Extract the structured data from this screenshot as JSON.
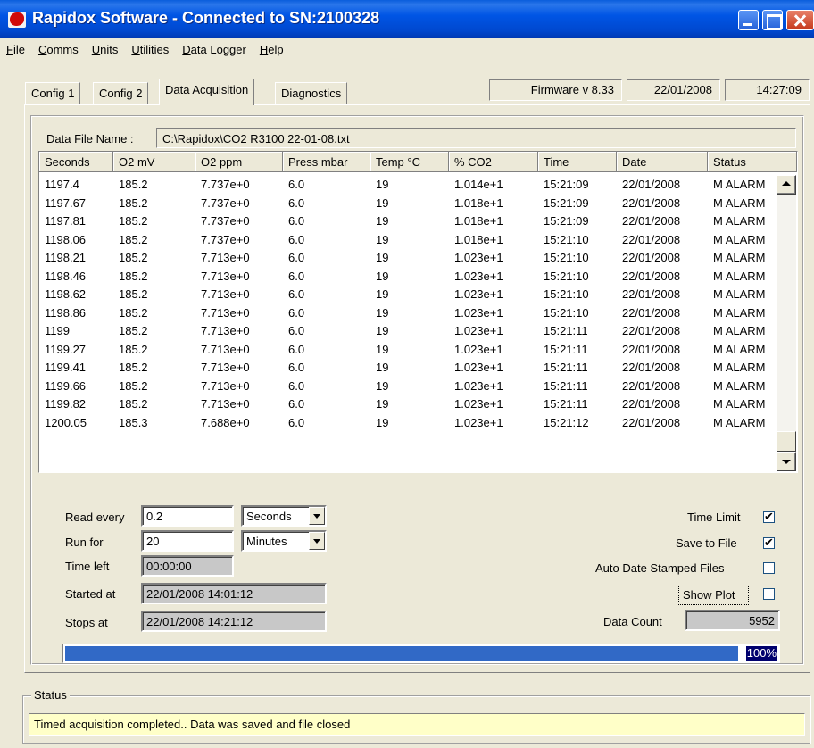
{
  "window": {
    "title": "Rapidox Software - Connected to SN:2100328"
  },
  "menu": [
    {
      "label": "File"
    },
    {
      "label": "Comms"
    },
    {
      "label": "Units"
    },
    {
      "label": "Utilities"
    },
    {
      "label": "Data Logger"
    },
    {
      "label": "Help"
    }
  ],
  "tabs": [
    {
      "label": "Config 1"
    },
    {
      "label": "Config 2"
    },
    {
      "label": "Data Acquisition"
    },
    {
      "label": "Diagnostics"
    }
  ],
  "info": {
    "firmware": "Firmware v 8.33",
    "date": "22/01/2008",
    "time": "14:27:09"
  },
  "data_file": {
    "label": "Data File Name :",
    "path": "C:\\Rapidox\\CO2 R3100 22-01-08.txt"
  },
  "table": {
    "headers": [
      "Seconds",
      "O2 mV",
      "O2 ppm",
      "Press mbar",
      "Temp °C",
      "% CO2",
      "Time",
      "Date",
      "Status"
    ],
    "rows": [
      [
        "1197.4",
        "185.2",
        "7.737e+0",
        "6.0",
        "19",
        "1.014e+1",
        "15:21:09",
        "22/01/2008",
        "M  ALARM"
      ],
      [
        "1197.67",
        "185.2",
        "7.737e+0",
        "6.0",
        "19",
        "1.018e+1",
        "15:21:09",
        "22/01/2008",
        "M  ALARM"
      ],
      [
        "1197.81",
        "185.2",
        "7.737e+0",
        "6.0",
        "19",
        "1.018e+1",
        "15:21:09",
        "22/01/2008",
        "M  ALARM"
      ],
      [
        "1198.06",
        "185.2",
        "7.737e+0",
        "6.0",
        "19",
        "1.018e+1",
        "15:21:10",
        "22/01/2008",
        "M  ALARM"
      ],
      [
        "1198.21",
        "185.2",
        "7.713e+0",
        "6.0",
        "19",
        "1.023e+1",
        "15:21:10",
        "22/01/2008",
        "M  ALARM"
      ],
      [
        "1198.46",
        "185.2",
        "7.713e+0",
        "6.0",
        "19",
        "1.023e+1",
        "15:21:10",
        "22/01/2008",
        "M  ALARM"
      ],
      [
        "1198.62",
        "185.2",
        "7.713e+0",
        "6.0",
        "19",
        "1.023e+1",
        "15:21:10",
        "22/01/2008",
        "M  ALARM"
      ],
      [
        "1198.86",
        "185.2",
        "7.713e+0",
        "6.0",
        "19",
        "1.023e+1",
        "15:21:10",
        "22/01/2008",
        "M  ALARM"
      ],
      [
        "1199",
        "185.2",
        "7.713e+0",
        "6.0",
        "19",
        "1.023e+1",
        "15:21:11",
        "22/01/2008",
        "M  ALARM"
      ],
      [
        "1199.27",
        "185.2",
        "7.713e+0",
        "6.0",
        "19",
        "1.023e+1",
        "15:21:11",
        "22/01/2008",
        "M  ALARM"
      ],
      [
        "1199.41",
        "185.2",
        "7.713e+0",
        "6.0",
        "19",
        "1.023e+1",
        "15:21:11",
        "22/01/2008",
        "M  ALARM"
      ],
      [
        "1199.66",
        "185.2",
        "7.713e+0",
        "6.0",
        "19",
        "1.023e+1",
        "15:21:11",
        "22/01/2008",
        "M  ALARM"
      ],
      [
        "1199.82",
        "185.2",
        "7.713e+0",
        "6.0",
        "19",
        "1.023e+1",
        "15:21:11",
        "22/01/2008",
        "M  ALARM"
      ],
      [
        "1200.05",
        "185.3",
        "7.688e+0",
        "6.0",
        "19",
        "1.023e+1",
        "15:21:12",
        "22/01/2008",
        "M  ALARM"
      ]
    ]
  },
  "controls": {
    "read_every": {
      "label": "Read every",
      "value": "0.2",
      "unit": "Seconds"
    },
    "run_for": {
      "label": "Run for",
      "value": "20",
      "unit": "Minutes"
    },
    "time_left": {
      "label": "Time left",
      "value": "00:00:00"
    },
    "started_at": {
      "label": "Started at",
      "value": "22/01/2008 14:01:12"
    },
    "stops_at": {
      "label": "Stops at",
      "value": "22/01/2008 14:21:12"
    },
    "time_limit": {
      "label": "Time Limit",
      "checked": true
    },
    "save_to_file": {
      "label": "Save to File",
      "checked": true
    },
    "auto_date": {
      "label": "Auto Date Stamped Files",
      "checked": false
    },
    "show_plot": {
      "label": "Show Plot",
      "checked": false
    },
    "data_count": {
      "label": "Data Count",
      "value": "5952"
    },
    "progress": {
      "value": 1.0,
      "label": "100%"
    }
  },
  "status": {
    "title": "Status",
    "message": "Timed acquisition completed.. Data was saved and file closed"
  },
  "colors": {
    "titlebar": "#0055e5",
    "progress_fill": "#3169c6",
    "status_bg": "#ffffc8"
  }
}
